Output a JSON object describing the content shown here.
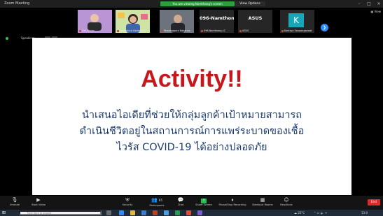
{
  "window": {
    "app_title": "Zoom Meeting",
    "share_banner": "You are viewing Namthong's screen",
    "view_options": "View Options"
  },
  "gallery": {
    "participants": [
      {
        "name": "Daf_Floren",
        "bg": "#7a4e9a"
      },
      {
        "name": "Saowaluck Nantaboot",
        "bg": "#6d9e54"
      },
      {
        "name": "Pewatsaporn Nakanay",
        "bg": "#3c3f46"
      },
      {
        "name": "096-Namthong-LC",
        "big": "096-Namthong...",
        "bg": "#232323"
      },
      {
        "name": "ASUS",
        "big": "ASUS",
        "bg": "#232323"
      },
      {
        "name": "Kanlaya Sanpongsawat",
        "avatar_letter": "K",
        "bg": "#232323"
      }
    ],
    "view_label": "View"
  },
  "speaking": {
    "text": "Speaking:"
  },
  "slide": {
    "title": "Activity!!",
    "lines": [
      "นำเสนอไอเดียที่ช่วยให้กลุ่มลูกค้าเป้าหมายสามารถ",
      "ดำเนินชีวิตอยู่ในสถานการณ์การแพร่ระบาดของเชื้อ",
      "ไวรัส COVID-19 ได้อย่างปลอดภัย"
    ],
    "title_color": "#c8161d",
    "body_color": "#1f3d6e"
  },
  "toolbar": {
    "unmute": "Unmute",
    "start_video": "Start Video",
    "security": "Security",
    "participants": "Participants",
    "participants_count": "65",
    "chat": "Chat",
    "share_screen": "Share Screen",
    "pause_share": "Pause/Stop Recording",
    "breakout_rooms": "Breakout Rooms",
    "reactions": "Reactions",
    "end": "End"
  },
  "taskbar": {
    "search_placeholder": "Type here to search",
    "weather": "25°C",
    "time": "13:0"
  }
}
